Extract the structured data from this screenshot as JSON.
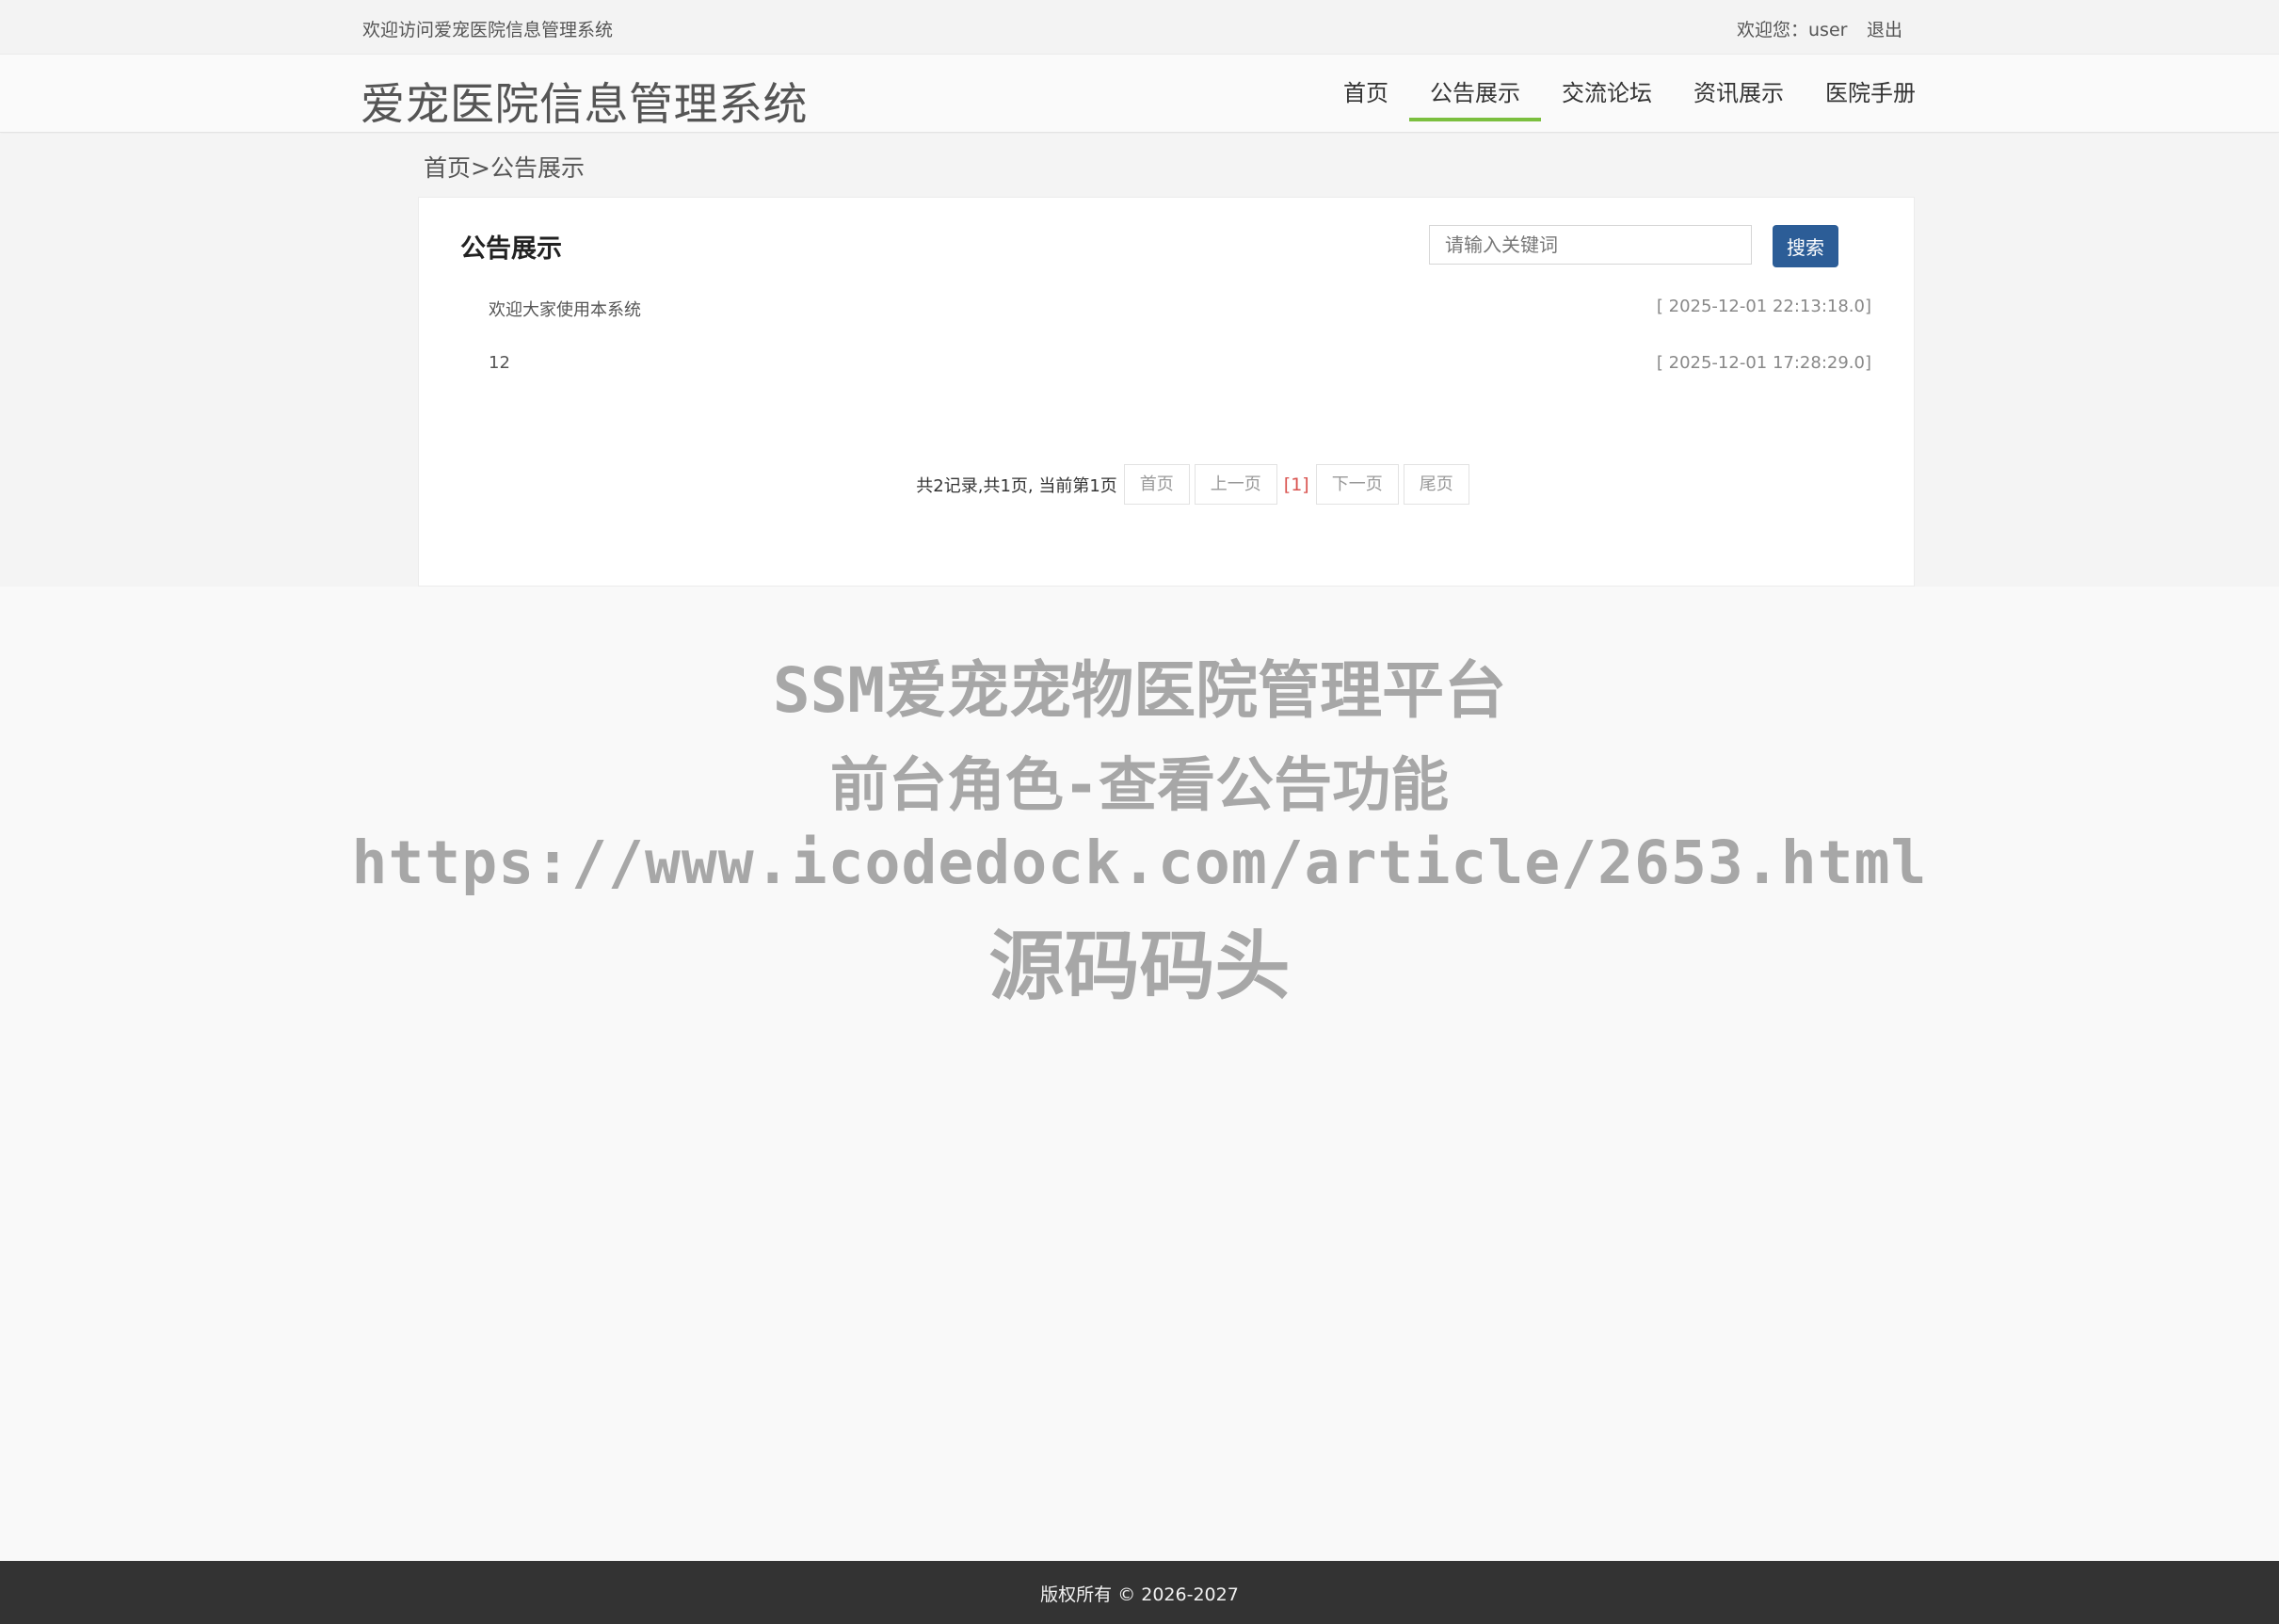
{
  "topbar": {
    "welcome": "欢迎访问爱宠医院信息管理系统",
    "greeting": "欢迎您：user",
    "logout": "退出"
  },
  "header": {
    "site_title": "爱宠医院信息管理系统",
    "nav": [
      {
        "label": "首页",
        "active": false
      },
      {
        "label": "公告展示",
        "active": true
      },
      {
        "label": "交流论坛",
        "active": false
      },
      {
        "label": "资讯展示",
        "active": false
      },
      {
        "label": "医院手册",
        "active": false
      }
    ],
    "accent_color": "#7bbf3f"
  },
  "breadcrumb": {
    "home": "首页",
    "separator": ">",
    "current": "公告展示"
  },
  "panel": {
    "title": "公告展示",
    "search": {
      "placeholder": "请输入关键词",
      "value": "",
      "button_label": "搜索",
      "button_color": "#2c5d97"
    },
    "notices": [
      {
        "title": "欢迎大家使用本系统",
        "date": "[ 2025-12-01 22:13:18.0]"
      },
      {
        "title": "12",
        "date": "[ 2025-12-01 17:28:29.0]"
      }
    ],
    "pagination": {
      "summary": "共2记录,共1页, 当前第1页",
      "first": "首页",
      "prev": "上一页",
      "current": "[1]",
      "next": "下一页",
      "last": "尾页"
    }
  },
  "watermark": {
    "line1": "SSM爱宠宠物医院管理平台",
    "line2": "前台角色-查看公告功能",
    "line3": "https://www.icodedock.com/article/2653.html",
    "line4": "源码码头"
  },
  "footer": {
    "copyright": "版权所有 © 2026-2027"
  }
}
